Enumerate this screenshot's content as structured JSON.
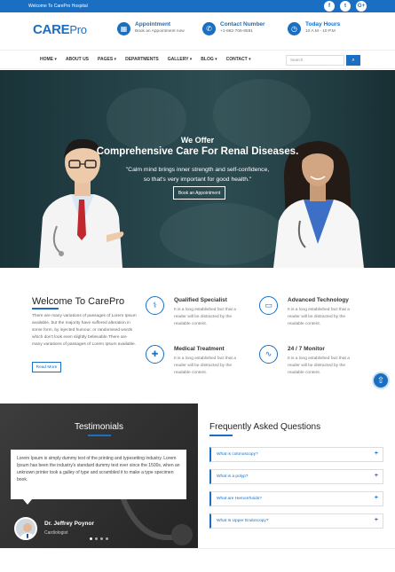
{
  "topbar": {
    "welcome": "Welcome To CarePro Hospital",
    "social": [
      {
        "icon": "facebook-icon",
        "glyph": "f"
      },
      {
        "icon": "twitter-icon",
        "glyph": "t"
      },
      {
        "icon": "google-plus-icon",
        "glyph": "G+"
      }
    ]
  },
  "header": {
    "logo_a": "CA",
    "logo_b": "RE",
    "logo_c": "Pro",
    "appointment": {
      "title": "Appointment",
      "text": "Book an Appointment now",
      "icon": "calendar-icon"
    },
    "contact": {
      "title": "Contact Number",
      "text": "+1-662-705-8591",
      "icon": "phone-icon"
    },
    "hours": {
      "title": "Today Hours",
      "text": "10 A.M - 10 P.M",
      "icon": "clock-icon"
    }
  },
  "nav": {
    "items": [
      "HOME ▾",
      "ABOUT US",
      "PAGES ▾",
      "DEPARTMENTS",
      "GALLERY ▾",
      "BLOG ▾",
      "CONTACT ▾"
    ],
    "search_placeholder": "Search"
  },
  "hero": {
    "we_offer": "We Offer",
    "heading": "Comprehensive Care For Renal Diseases.",
    "quote_line1": "\"Calm mind brings inner strength and self-confidence,",
    "quote_line2": "so that's very important for good health.\"",
    "button": "Book an Appointment"
  },
  "welcome": {
    "title": "Welcome To CarePro",
    "text": "There are many variations of passages of Lorem Ipsum available, but the majority have suffered alteration in some form, by injected humour, or randomised words which don't look even slightly believable.There are many variations of passages of Lorem Ipsum available.",
    "button": "Read More",
    "features": [
      {
        "title": "Qualified Specialist",
        "text": "It is a long established fact that a reader will be distracted by the readable content.",
        "icon": "doctor-icon"
      },
      {
        "title": "Advanced Technology",
        "text": "It is a long established fact that a reader will be distracted by the readable content.",
        "icon": "monitor-icon"
      },
      {
        "title": "Medical Treatment",
        "text": "It is a long established fact that a reader will be distracted by the readable content.",
        "icon": "medical-cross-icon"
      },
      {
        "title": "24 / 7 Monitor",
        "text": "It is a long established fact that a reader will be distracted by the readable content.",
        "icon": "stethoscope-icon"
      }
    ]
  },
  "testimonials": {
    "title": "Testimonials",
    "quote": "Lorem Ipsum is simply dummy text of the printing and typesetting industry. Lorem Ipsum has been the industry's standard dummy text ever since the 1500s, when an unknown printer took a galley of type and scrambled it to make a type specimen book.",
    "name": "Dr. Jeffrey Poynor",
    "role": "Cardiologist"
  },
  "faq": {
    "title": "Frequently Asked Questions",
    "items": [
      "What is colonoscopy?",
      "What is a polyp?",
      "What are Hemorrhoids?",
      "What Is Upper Endoscopy?"
    ]
  },
  "colors": {
    "primary": "#1a6fc2"
  }
}
